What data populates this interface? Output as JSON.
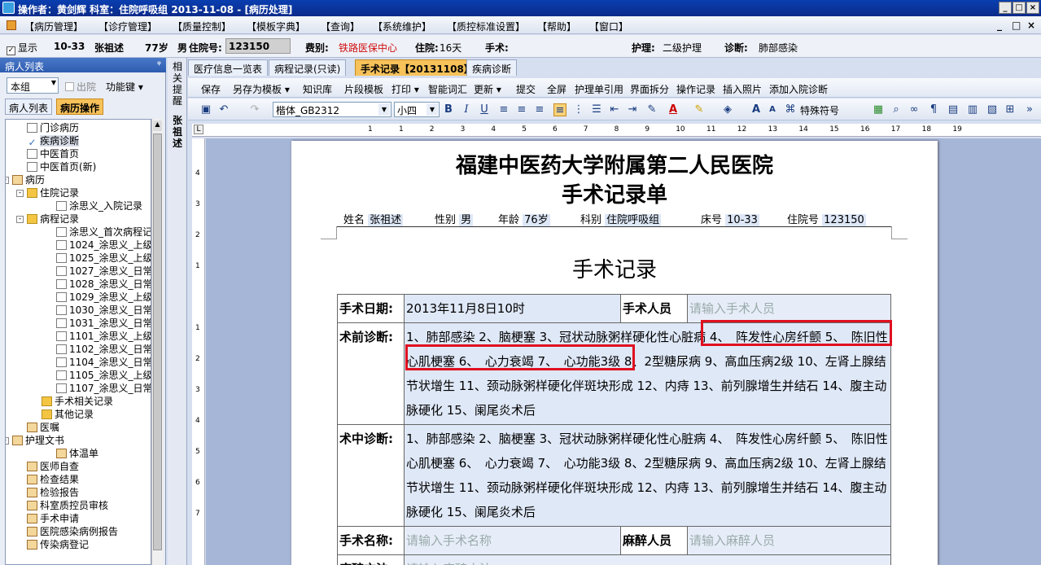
{
  "window": {
    "title": "操作者：黄剑辉   科室：住院呼吸组   2013-11-08 - [病历处理]",
    "controls": [
      "_",
      "□",
      "×"
    ]
  },
  "menu": {
    "items": [
      "【病历管理】",
      "【诊疗管理】",
      "【质量控制】",
      "【模板字典】",
      "【查询】",
      "【系统维护】",
      "【质控标准设置】",
      "【帮助】",
      "【窗口】"
    ],
    "controls": [
      "_",
      "□",
      "×"
    ]
  },
  "patient": {
    "show_label": "显示",
    "bed": "10-33",
    "name": "张祖述",
    "age": "77岁",
    "sex": "男",
    "admission_label": "住院号:",
    "admission_no": "123150",
    "fee_label": "费别:",
    "fee_value": "铁路医保中心",
    "stay_label": "住院:",
    "stay_value": "16天",
    "surgery_label": "手术:",
    "nursing_label": "护理:",
    "nursing_value": "二级护理",
    "diagnosis_label": "诊断:",
    "diagnosis_value": "肺部感染"
  },
  "left_panel": {
    "title": "病人列表",
    "pin": "ᵠ",
    "group_value": "本组",
    "discharge_label": "出院",
    "function_label": "功能键",
    "tabs": [
      "病人列表",
      "病历操作"
    ],
    "tree": [
      {
        "label": "门诊病历",
        "indent": 1,
        "icon": "doc"
      },
      {
        "label": "疾病诊断",
        "indent": 1,
        "icon": "chk"
      },
      {
        "label": "中医首页",
        "indent": 1,
        "icon": "doc"
      },
      {
        "label": "中医首页(新)",
        "indent": 1,
        "icon": "doc"
      },
      {
        "label": "病历",
        "indent": 0,
        "icon": "misc",
        "exp": "-"
      },
      {
        "label": "住院记录",
        "indent": 1,
        "icon": "fold",
        "exp": "-"
      },
      {
        "label": "涂思义_入院记录",
        "indent": 3,
        "icon": "doc"
      },
      {
        "label": "病程记录",
        "indent": 1,
        "icon": "fold",
        "exp": "-"
      },
      {
        "label": "涂思义_首次病程记",
        "indent": 3,
        "icon": "doc"
      },
      {
        "label": "1024_涂思义_上级",
        "indent": 3,
        "icon": "doc"
      },
      {
        "label": "1025_涂思义_上级",
        "indent": 3,
        "icon": "doc"
      },
      {
        "label": "1027_涂思义_日常",
        "indent": 3,
        "icon": "doc"
      },
      {
        "label": "1028_涂思义_日常",
        "indent": 3,
        "icon": "doc"
      },
      {
        "label": "1029_涂思义_上级",
        "indent": 3,
        "icon": "doc"
      },
      {
        "label": "1030_涂思义_日常",
        "indent": 3,
        "icon": "doc"
      },
      {
        "label": "1031_涂思义_日常",
        "indent": 3,
        "icon": "doc"
      },
      {
        "label": "1101_涂思义_上级",
        "indent": 3,
        "icon": "doc"
      },
      {
        "label": "1102_涂思义_日常",
        "indent": 3,
        "icon": "doc"
      },
      {
        "label": "1104_涂思义_日常",
        "indent": 3,
        "icon": "doc"
      },
      {
        "label": "1105_涂思义_上级",
        "indent": 3,
        "icon": "doc"
      },
      {
        "label": "1107_涂思义_日常",
        "indent": 3,
        "icon": "doc"
      },
      {
        "label": "手术相关记录",
        "indent": 2,
        "icon": "fold"
      },
      {
        "label": "其他记录",
        "indent": 2,
        "icon": "fold"
      },
      {
        "label": "医嘱",
        "indent": 1,
        "icon": "misc"
      },
      {
        "label": "护理文书",
        "indent": 0,
        "icon": "misc",
        "exp": "-"
      },
      {
        "label": "体温单",
        "indent": 3,
        "icon": "misc"
      },
      {
        "label": "医师自查",
        "indent": 1,
        "icon": "misc"
      },
      {
        "label": "检查结果",
        "indent": 1,
        "icon": "misc"
      },
      {
        "label": "检验报告",
        "indent": 1,
        "icon": "misc"
      },
      {
        "label": "科室质控员审核",
        "indent": 1,
        "icon": "misc"
      },
      {
        "label": "手术申请",
        "indent": 1,
        "icon": "misc"
      },
      {
        "label": "医院感染病例报告",
        "indent": 1,
        "icon": "misc"
      },
      {
        "label": "传染病登记",
        "indent": 1,
        "icon": "misc"
      }
    ]
  },
  "vtabs": {
    "remind": "相关提醒",
    "patient_name": "张祖述"
  },
  "doc_tabs": [
    "医疗信息一览表",
    "病程记录(只读)",
    "手术记录【20131108】",
    "疾病诊断"
  ],
  "actions": [
    "保存",
    "另存为模板",
    "知识库",
    "片段模板",
    "打印",
    "智能词汇",
    "更新",
    "提交",
    "全屏",
    "护理单引用",
    "界面拆分",
    "操作记录",
    "插入照片",
    "添加入院诊断"
  ],
  "format": {
    "font": "楷体_GB2312",
    "size": "小四",
    "special_symbol": "特殊符号"
  },
  "ruler": {
    "h": [
      "1",
      "1",
      "2",
      "3",
      "4",
      "5",
      "6",
      "7",
      "8",
      "9",
      "10",
      "11",
      "12",
      "13",
      "14",
      "15",
      "16",
      "17",
      "18",
      "19"
    ],
    "v": [
      "4",
      "3",
      "2",
      "1",
      "1",
      "2",
      "3",
      "4",
      "5",
      "6",
      "7"
    ]
  },
  "document": {
    "hospital": "福建中医药大学附属第二人民医院",
    "form_title": "手术记录单",
    "header": {
      "name_label": "姓名",
      "name": "张祖述",
      "sex_label": "性别",
      "sex": "男",
      "age_label": "年龄",
      "age": "76岁",
      "dept_label": "科别",
      "dept": "住院呼吸组",
      "bed_label": "床号",
      "bed": "10-33",
      "admission_label": "住院号",
      "admission": "123150"
    },
    "section_title": "手术记录",
    "date_label": "手术日期:",
    "date_value": "2013年11月8日10时",
    "staff_label": "手术人员",
    "staff_placeholder": "请输入手术人员",
    "pre_label": "术前诊断:",
    "pre_diag": "1、肺部感染 2、脑梗塞 3、冠状动脉粥样硬化性心脏病 4、　阵发性心房纤颤 5、　陈旧性心肌梗塞 6、　心力衰竭 7、　心功能3级 8、2型糖尿病 9、高血压病2级 10、左肾上腺结节状增生 11、颈动脉粥样硬化伴斑块形成 12、内痔 13、前列腺增生并结石 14、腹主动脉硬化 15、阑尾炎术后",
    "intra_label": "术中诊断:",
    "intra_diag": "1、肺部感染 2、脑梗塞 3、冠状动脉粥样硬化性心脏病 4、　阵发性心房纤颤 5、　陈旧性心肌梗塞 6、　心力衰竭 7、　心功能3级 8、2型糖尿病 9、高血压病2级 10、左肾上腺结节状增生 11、颈动脉粥样硬化伴斑块形成 12、内痔 13、前列腺增生并结石 14、腹主动脉硬化 15、阑尾炎术后",
    "op_label": "手术名称:",
    "op_placeholder": "请输入手术名称",
    "anes_staff_label": "麻醉人员",
    "anes_staff_placeholder": "请输入麻醉人员",
    "anes_method_label": "麻醉方法:",
    "anes_method_placeholder": "请输入麻醉方法"
  }
}
